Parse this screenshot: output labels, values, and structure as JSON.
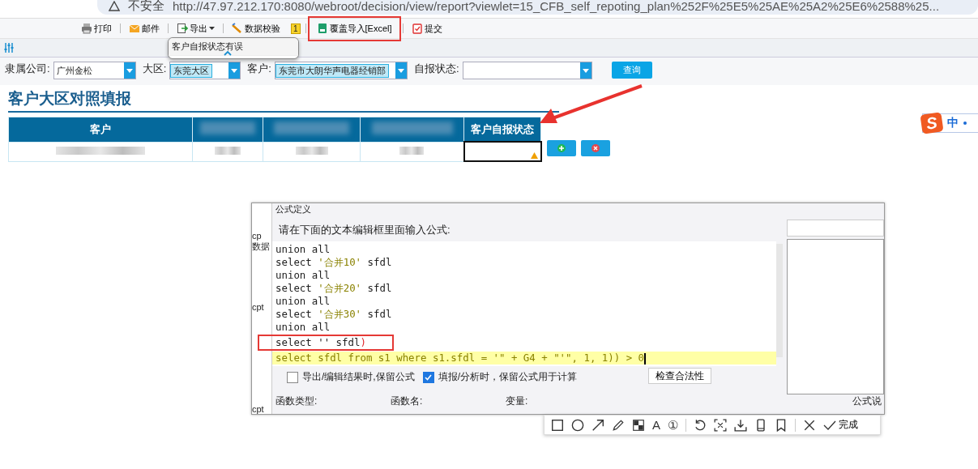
{
  "browser": {
    "security": "不安全",
    "url": "http://47.97.212.170:8080/webroot/decision/view/report?viewlet=15_CFB_self_repoting_plan%252F%25E5%25AE%25A2%25E6%2588%25..."
  },
  "toolbar": [
    {
      "kind": "print",
      "label": "打印",
      "caret": false,
      "outlined": false
    },
    {
      "kind": "mail",
      "label": "邮件",
      "caret": false,
      "outlined": false
    },
    {
      "kind": "export",
      "label": "导出",
      "caret": true,
      "outlined": false
    },
    {
      "kind": "check",
      "label": "数据校验",
      "badge": "1",
      "caret": false,
      "outlined": false
    },
    {
      "kind": "excel",
      "label": "覆盖导入[Excel]",
      "caret": false,
      "outlined": true
    },
    {
      "kind": "submit",
      "label": "提交",
      "caret": false,
      "outlined": false
    }
  ],
  "tooltip": {
    "text": "客户自报状态有误"
  },
  "filters": [
    {
      "label": "隶属公司:",
      "value": "广州金松",
      "highlighted": false
    },
    {
      "label": "大区:",
      "value": "东莞大区",
      "highlighted": true
    },
    {
      "label": "客户:",
      "value": "东莞市大朗华声电器经销部",
      "highlighted": true
    },
    {
      "label": "自报状态:",
      "highlighted": false
    }
  ],
  "query_button": "查询",
  "report": {
    "title": "客户大区对照填报",
    "columns": [
      {
        "label": "客户",
        "redacted": false
      },
      {
        "redacted": true
      },
      {
        "redacted": true
      },
      {
        "redacted": true
      },
      {
        "label": "客户自报状态",
        "redacted": false
      }
    ],
    "row": [
      {
        "kind": "redacted",
        "selected": false
      },
      {
        "kind": "redacted",
        "selected": false
      },
      {
        "kind": "redacted",
        "selected": false
      },
      {
        "kind": "redacted",
        "selected": false
      },
      {
        "kind": "status",
        "selected": true,
        "warning": true
      }
    ]
  },
  "ime": {
    "logo": "S",
    "mode": "中"
  },
  "formula_dialog": {
    "title": "公式定义",
    "side_texts": [
      "cp",
      "数据",
      "cpt",
      "cpt"
    ],
    "prompt": "请在下面的文本编辑框里面输入公式:",
    "lines": [
      {
        "current": false,
        "boxed": false,
        "parts": [
          {
            "kind": "code",
            "text": "union all"
          }
        ]
      },
      {
        "current": false,
        "boxed": false,
        "parts": [
          {
            "kind": "code",
            "text": "select "
          },
          {
            "kind": "string",
            "text": "'合并10'"
          },
          {
            "kind": "code",
            "text": " sfdl"
          }
        ]
      },
      {
        "current": false,
        "boxed": false,
        "parts": [
          {
            "kind": "code",
            "text": "union all"
          }
        ]
      },
      {
        "current": false,
        "boxed": false,
        "parts": [
          {
            "kind": "code",
            "text": "select "
          },
          {
            "kind": "string",
            "text": "'合并20'"
          },
          {
            "kind": "code",
            "text": " sfdl"
          }
        ]
      },
      {
        "current": false,
        "boxed": false,
        "parts": [
          {
            "kind": "code",
            "text": "union all"
          }
        ]
      },
      {
        "current": false,
        "boxed": false,
        "parts": [
          {
            "kind": "code",
            "text": "select "
          },
          {
            "kind": "string",
            "text": "'合并30'"
          },
          {
            "kind": "code",
            "text": " sfdl"
          }
        ]
      },
      {
        "current": false,
        "boxed": false,
        "parts": [
          {
            "kind": "code",
            "text": "union all"
          }
        ]
      },
      {
        "current": false,
        "boxed": true,
        "parts": [
          {
            "kind": "code",
            "text": "select '' sfdl"
          },
          {
            "kind": "paren",
            "text": ")"
          }
        ]
      },
      {
        "current": true,
        "boxed": false,
        "parts": [
          {
            "kind": "string",
            "text": "select sfdl from s1 where s1.sfdl = '\" + G4 + \"'\", 1, 1)) > 0"
          }
        ]
      }
    ],
    "options": [
      {
        "label": "导出/编辑结果时,保留公式",
        "checked": false
      },
      {
        "label": "填报/分析时，保留公式用于计算",
        "checked": true
      }
    ],
    "check_button": "检查合法性",
    "panels": [
      "函数类型:",
      "函数名:",
      "变量:",
      "公式说"
    ]
  },
  "capture_toolbar": {
    "tools": [
      {
        "kind": "rect"
      },
      {
        "kind": "circle"
      },
      {
        "kind": "arrow"
      },
      {
        "kind": "pencil"
      },
      {
        "kind": "mosaic"
      },
      {
        "kind": "text",
        "label": "A"
      },
      {
        "kind": "text",
        "label": "①"
      },
      {
        "kind": "sep"
      },
      {
        "kind": "undo"
      },
      {
        "kind": "scan"
      },
      {
        "kind": "download"
      },
      {
        "kind": "phone"
      },
      {
        "kind": "bookmark"
      },
      {
        "kind": "sep"
      },
      {
        "kind": "close"
      }
    ],
    "done": "完成"
  }
}
